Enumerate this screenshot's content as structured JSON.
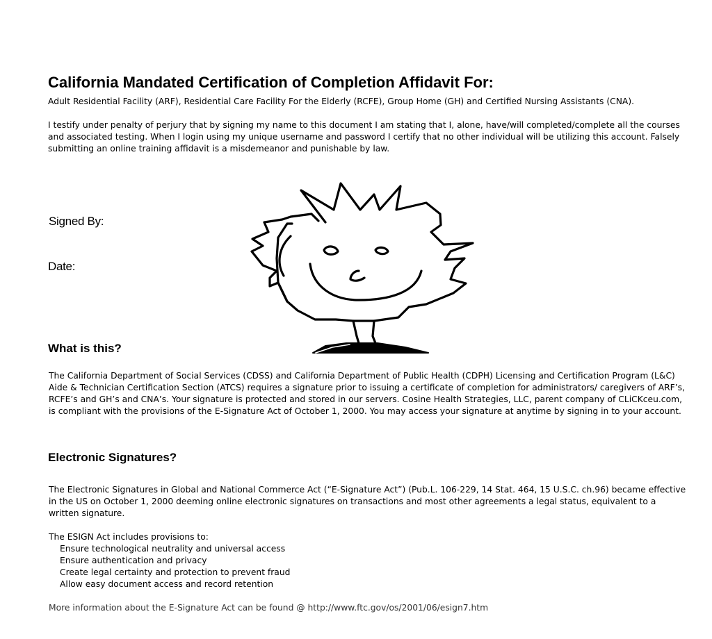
{
  "title": "California Mandated Certification of Completion Affidavit For:",
  "subtitle": "Adult Residential Facility (ARF), Residential Care Facility For the Elderly (RCFE), Group Home (GH) and Certified Nursing Assistants (CNA).",
  "testify": "I testify under penalty of perjury that by signing my name to this document I am stating that I, alone, have/will completed/complete all the courses and associated testing. When I login using my unique username and password I certify that no other individual will be utilizing this account. Falsely submitting an online training affidavit is a misdemeanor and punishable by law.",
  "signed_by_label": "Signed By:",
  "date_label": "Date:",
  "what_heading": "What is this?",
  "what_text": "The California Department of Social Services (CDSS) and California Department of Public Health (CDPH) Licensing and Certification Program (L&C) Aide & Technician Certification Section (ATCS) requires a signature prior to issuing a certificate of completion for administrators/ caregivers of ARF’s, RCFE’s and GH’s and CNA’s. Your signature is protected and stored in our servers. Cosine Health Strategies, LLC, parent company of CLiCKceu.com, is compliant with the provisions of the E-Signature Act of October 1, 2000. You may access your signature at anytime by signing in to your account.",
  "esig_heading": "Electronic Signatures?",
  "esig_text": "The Electronic Signatures in Global and National Commerce Act (“E-Signature Act”) (Pub.L. 106-229, 14 Stat. 464, 15 U.S.C. ch.96) became effective in the US on October 1, 2000 deeming online electronic signatures on transactions and most other agreements a legal status, equivalent to a written signature.",
  "esign_intro": "The ESIGN Act includes provisions to:",
  "esign_items": [
    "Ensure technological neutrality and universal access",
    "Ensure authentication and privacy",
    "Create legal certainty and protection to prevent fraud",
    "Allow easy document access and record retention"
  ],
  "more_info": "More information about the E-Signature Act can be found @ http://www.ftc.gov/os/2001/06/esign7.htm"
}
